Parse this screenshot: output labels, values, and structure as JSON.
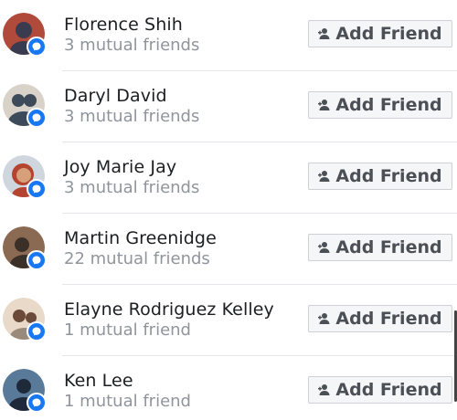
{
  "friends": [
    {
      "name": "Florence Shih",
      "mutual": "3 mutual friends",
      "button": "Add Friend",
      "avatar_color": "#b04a3a",
      "avatar_accent": "#3b3b4f"
    },
    {
      "name": "Daryl David",
      "mutual": "3 mutual friends",
      "button": "Add Friend",
      "avatar_color": "#d9d2c8",
      "avatar_accent": "#3c4a5a"
    },
    {
      "name": "Joy Marie Jay",
      "mutual": "3 mutual friends",
      "button": "Add Friend",
      "avatar_color": "#d8a07a",
      "avatar_accent": "#b4432f"
    },
    {
      "name": "Martin Greenidge",
      "mutual": "22 mutual friends",
      "button": "Add Friend",
      "avatar_color": "#8a6a52",
      "avatar_accent": "#3a3028"
    },
    {
      "name": "Elayne Rodriguez Kelley",
      "mutual": "1 mutual friend",
      "button": "Add Friend",
      "avatar_color": "#e8d9c8",
      "avatar_accent": "#6b4a3a"
    },
    {
      "name": "Ken Lee",
      "mutual": "1 mutual friend",
      "button": "Add Friend",
      "avatar_color": "#5a7a9a",
      "avatar_accent": "#1e2a3a"
    }
  ],
  "icons": {
    "badge": "messenger-badge-icon",
    "button": "add-friend-person-icon"
  },
  "colors": {
    "badge": "#1877f2",
    "name": "#1c1e21",
    "mutual": "#90949c",
    "button_text": "#4b4f56"
  }
}
